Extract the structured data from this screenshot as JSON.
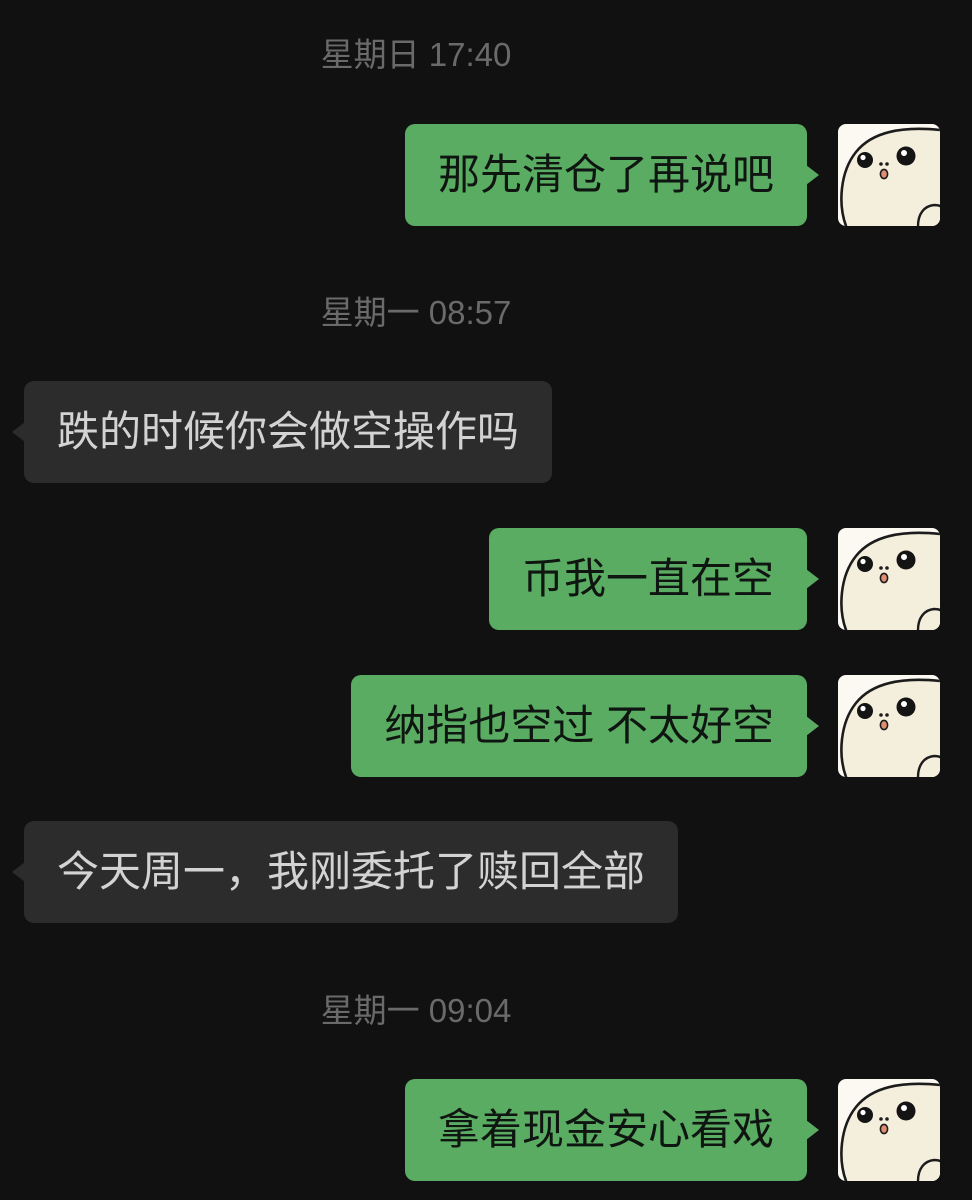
{
  "colors": {
    "background": "#111111",
    "sent_bubble": "#5aac62",
    "sent_text": "#0f1510",
    "received_bubble": "#2c2c2c",
    "received_text": "#d3d3d3",
    "timestamp": "#6a6a6a"
  },
  "avatar_icon": "seal-avatar-icon",
  "timeline": [
    {
      "timestamp": "星期日 17:40",
      "messages": [
        {
          "sent": "那先清仓了再说吧"
        }
      ]
    },
    {
      "timestamp": "星期一 08:57",
      "messages": [
        {
          "received": "跌的时候你会做空操作吗"
        },
        {
          "sent": "币我一直在空"
        },
        {
          "sent": "纳指也空过 不太好空"
        },
        {
          "received": "今天周一，我刚委托了赎回全部"
        }
      ]
    },
    {
      "timestamp": "星期一 09:04",
      "messages": [
        {
          "sent": "拿着现金安心看戏"
        }
      ]
    }
  ]
}
